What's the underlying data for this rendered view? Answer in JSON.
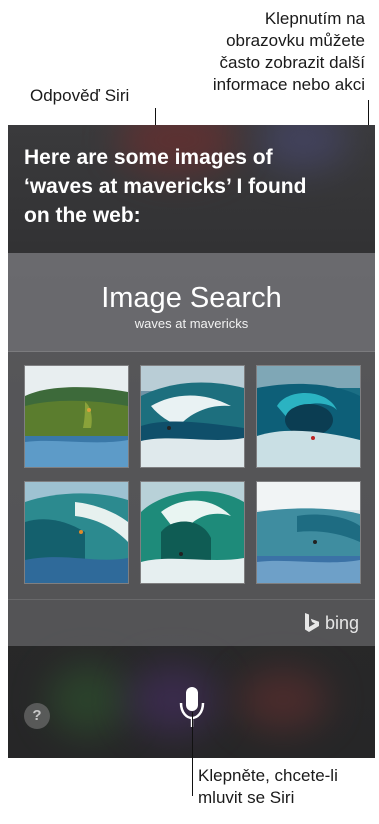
{
  "callouts": {
    "tap_more": "Klepnutím na\nobrazovku můžete\nčasto zobrazit další\ninformace nebo akci",
    "tap_more_lines": [
      "Klepnutím na",
      "obrazovku můžete",
      "často zobrazit další",
      "informace nebo akci"
    ],
    "siri_response": "Odpověď Siri",
    "tap_to_speak_lines": [
      "Klepněte, chcete-li",
      "mluvit se Siri"
    ]
  },
  "siri": {
    "response_lines": [
      "Here are some images of",
      "‘waves at mavericks’ I found",
      "on the web:"
    ]
  },
  "card": {
    "title": "Image Search",
    "subtitle": "waves at mavericks",
    "thumbnails": [
      {
        "name": "wave-image-1"
      },
      {
        "name": "wave-image-2"
      },
      {
        "name": "wave-image-3"
      },
      {
        "name": "wave-image-4"
      },
      {
        "name": "wave-image-5"
      },
      {
        "name": "wave-image-6"
      }
    ],
    "provider": "bing"
  },
  "controls": {
    "help_label": "?",
    "mic_icon": "microphone-icon"
  },
  "colors": {
    "screen_bg": "#2e2e30",
    "card_bg": "#7a7a7e",
    "text_white": "#ffffff",
    "wave_teal": "#1f7f86",
    "wave_deep": "#0f4f6a"
  }
}
